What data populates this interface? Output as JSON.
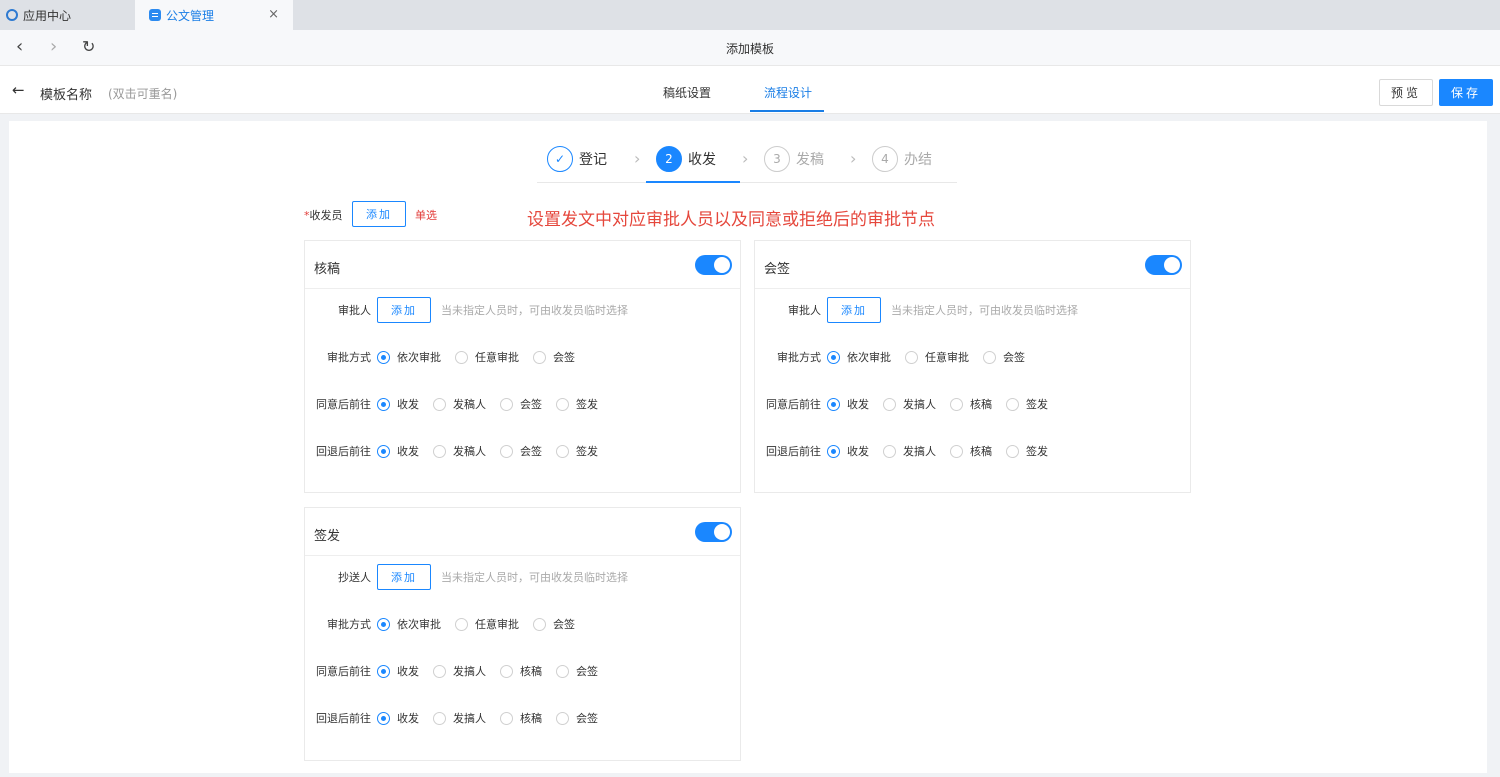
{
  "browser": {
    "tabs": [
      {
        "label": "应用中心"
      },
      {
        "label": "公文管理"
      }
    ],
    "close_glyph": "×",
    "nav_back": "‹",
    "nav_forward": "›",
    "nav_refresh": "↻",
    "title": "添加模板"
  },
  "header": {
    "back_glyph": "←",
    "template_name": "模板名称",
    "rename_hint": "(双击可重名)",
    "tabs": [
      "稿纸设置",
      "流程设计"
    ],
    "active_tab": "流程设计",
    "preview_label": "预览",
    "save_label": "保存"
  },
  "steps": [
    {
      "number": "✓",
      "label": "登记",
      "state": "done"
    },
    {
      "number": "2",
      "label": "收发",
      "state": "current"
    },
    {
      "number": "3",
      "label": "发稿",
      "state": "pending"
    },
    {
      "number": "4",
      "label": "办结",
      "state": "pending"
    }
  ],
  "step_separator": "›",
  "sender": {
    "required_mark": "*",
    "label": "收发员",
    "add_label": "添加",
    "mode_text": "单选"
  },
  "annotation": "设置发文中对应审批人员以及同意或拒绝后的审批节点",
  "cards": [
    {
      "title": "核稿",
      "enabled": true,
      "person_label": "审批人",
      "add_label": "添加",
      "hint": "当未指定人员时，可由收发员临时选择",
      "method_label": "审批方式",
      "method_options": [
        "依次审批",
        "任意审批",
        "会签"
      ],
      "method_selected": 0,
      "agree_label": "同意后前往",
      "agree_options": [
        "收发",
        "发稿人",
        "会签",
        "签发"
      ],
      "agree_selected": 0,
      "reject_label": "回退后前往",
      "reject_options": [
        "收发",
        "发稿人",
        "会签",
        "签发"
      ],
      "reject_selected": 0
    },
    {
      "title": "会签",
      "enabled": true,
      "person_label": "审批人",
      "add_label": "添加",
      "hint": "当未指定人员时，可由收发员临时选择",
      "method_label": "审批方式",
      "method_options": [
        "依次审批",
        "任意审批",
        "会签"
      ],
      "method_selected": 0,
      "agree_label": "同意后前往",
      "agree_options": [
        "收发",
        "发搞人",
        "核稿",
        "签发"
      ],
      "agree_selected": 0,
      "reject_label": "回退后前往",
      "reject_options": [
        "收发",
        "发搞人",
        "核稿",
        "签发"
      ],
      "reject_selected": 0
    },
    {
      "title": "签发",
      "enabled": true,
      "person_label": "抄送人",
      "add_label": "添加",
      "hint": "当未指定人员时，可由收发员临时选择",
      "method_label": "审批方式",
      "method_options": [
        "依次审批",
        "任意审批",
        "会签"
      ],
      "method_selected": 0,
      "agree_label": "同意后前往",
      "agree_options": [
        "收发",
        "发搞人",
        "核稿",
        "会签"
      ],
      "agree_selected": 0,
      "reject_label": "回退后前往",
      "reject_options": [
        "收发",
        "发搞人",
        "核稿",
        "会签"
      ],
      "reject_selected": 0
    }
  ],
  "colors": {
    "accent": "#1a87ff",
    "annotation": "#e5473c",
    "required": "#e23c39"
  }
}
